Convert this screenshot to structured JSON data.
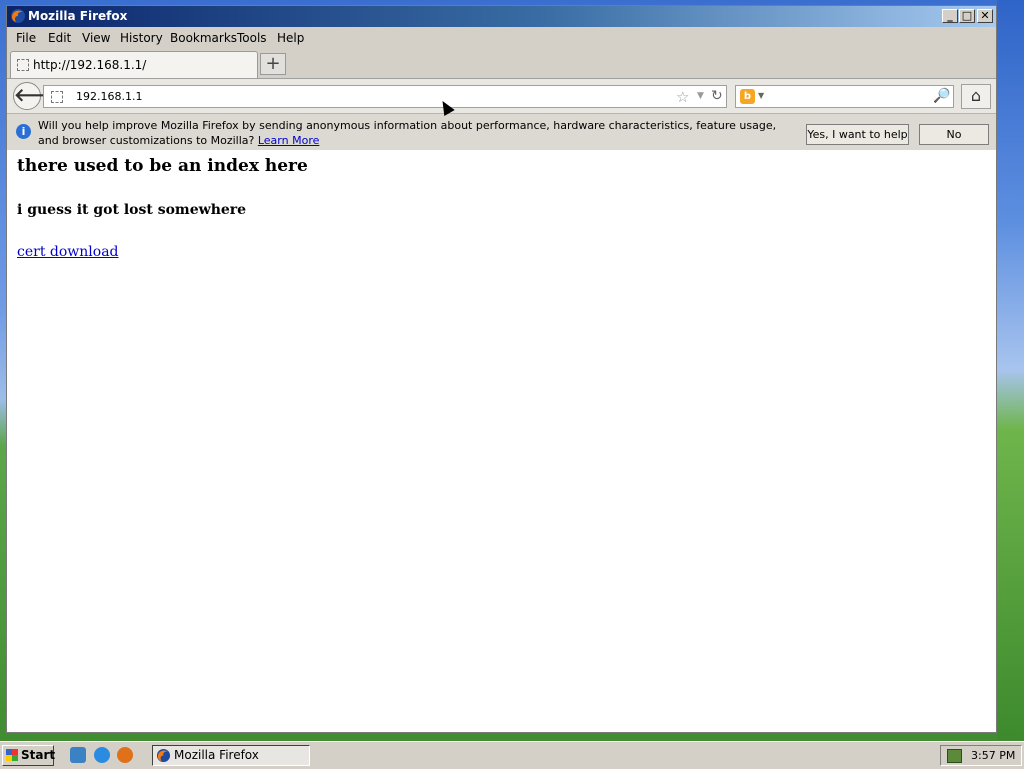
{
  "window": {
    "title": "Mozilla Firefox"
  },
  "menubar": [
    "File",
    "Edit",
    "View",
    "History",
    "Bookmarks",
    "Tools",
    "Help"
  ],
  "tab": {
    "label": "http://192.168.1.1/",
    "new_tab": "+"
  },
  "navbar": {
    "url": "192.168.1.1"
  },
  "infobar": {
    "message": "Will you help improve Mozilla Firefox by sending anonymous information about performance, hardware characteristics, feature usage, and browser customizations to Mozilla?",
    "learn_more": "Learn More",
    "yes_button": "Yes, I want to help",
    "no_button": "No"
  },
  "page": {
    "heading": "there used to be an index here",
    "subheading": "i guess it got lost somewhere",
    "link": "cert download"
  },
  "taskbar": {
    "start": "Start",
    "task": "Mozilla Firefox",
    "clock": "3:57 PM"
  },
  "colors": {
    "titlebar": "#0a246a",
    "link": "#0000cc",
    "info_icon": "#2a6fd6"
  }
}
